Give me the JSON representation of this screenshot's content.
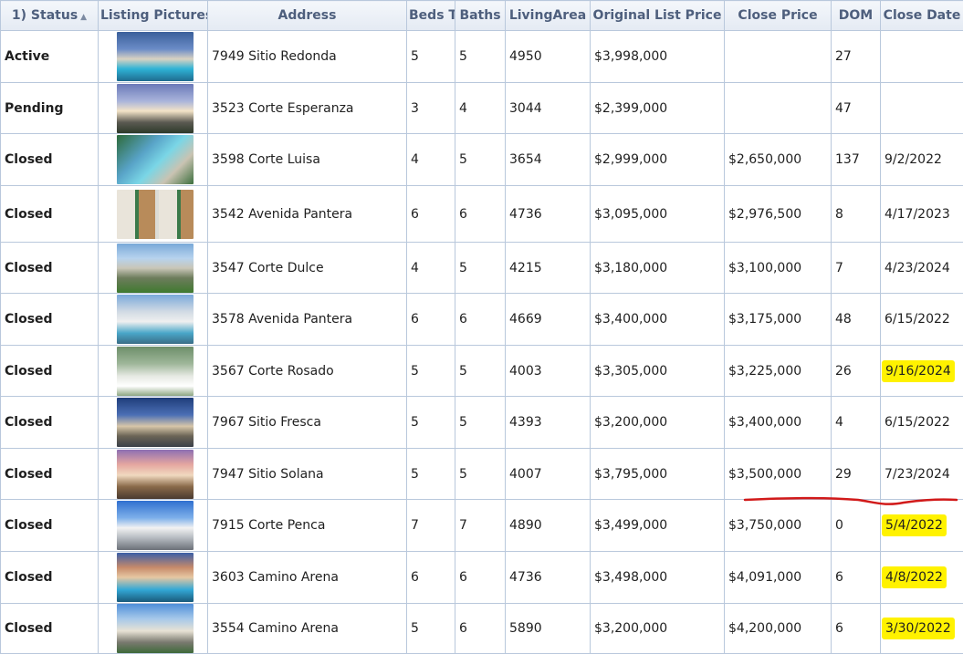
{
  "columns": [
    {
      "label": "1) Status",
      "sort_icon": "sort-arrows-icon"
    },
    {
      "label": "Listing Pictures"
    },
    {
      "label": "Address"
    },
    {
      "label": "Beds Total"
    },
    {
      "label": "Baths"
    },
    {
      "label": "LivingArea"
    },
    {
      "label": "Original List Price"
    },
    {
      "label": "Close Price"
    },
    {
      "label": "DOM"
    },
    {
      "label": "Close Date"
    }
  ],
  "rows": [
    {
      "status": "Active",
      "address": "7949 Sitio Redonda",
      "beds": "5",
      "baths": "5",
      "area": "4950",
      "orig": "$3,998,000",
      "close": "",
      "dom": "27",
      "date": "",
      "highlight": false,
      "photo": "pool-villa"
    },
    {
      "status": "Pending",
      "address": "3523 Corte Esperanza",
      "beds": "3",
      "baths": "4",
      "area": "3044",
      "orig": "$2,399,000",
      "close": "",
      "dom": "47",
      "date": "",
      "highlight": false,
      "photo": "house-dusk"
    },
    {
      "status": "Closed",
      "address": "3598 Corte Luisa",
      "beds": "4",
      "baths": "5",
      "area": "3654",
      "orig": "$2,999,000",
      "close": "$2,650,000",
      "dom": "137",
      "date": "9/2/2022",
      "highlight": false,
      "photo": "pool-aerial"
    },
    {
      "status": "Closed",
      "address": "3542 Avenida Pantera",
      "beds": "6",
      "baths": "6",
      "area": "4736",
      "orig": "$3,095,000",
      "close": "$2,976,500",
      "dom": "8",
      "date": "4/17/2023",
      "highlight": false,
      "photo": "collage"
    },
    {
      "status": "Closed",
      "address": "3547 Corte Dulce",
      "beds": "4",
      "baths": "5",
      "area": "4215",
      "orig": "$3,180,000",
      "close": "$3,100,000",
      "dom": "7",
      "date": "4/23/2024",
      "highlight": false,
      "photo": "house-lawn"
    },
    {
      "status": "Closed",
      "address": "3578 Avenida Pantera",
      "beds": "6",
      "baths": "6",
      "area": "4669",
      "orig": "$3,400,000",
      "close": "$3,175,000",
      "dom": "48",
      "date": "6/15/2022",
      "highlight": false,
      "photo": "pool-palms"
    },
    {
      "status": "Closed",
      "address": "3567 Corte Rosado",
      "beds": "5",
      "baths": "5",
      "area": "4003",
      "orig": "$3,305,000",
      "close": "$3,225,000",
      "dom": "26",
      "date": "9/16/2024",
      "highlight": true,
      "photo": "garden"
    },
    {
      "status": "Closed",
      "address": "7967 Sitio Fresca",
      "beds": "5",
      "baths": "5",
      "area": "4393",
      "orig": "$3,200,000",
      "close": "$3,400,000",
      "dom": "4",
      "date": "6/15/2022",
      "highlight": false,
      "photo": "house-night"
    },
    {
      "status": "Closed",
      "address": "7947 Sitio Solana",
      "beds": "5",
      "baths": "5",
      "area": "4007",
      "orig": "$3,795,000",
      "close": "$3,500,000",
      "dom": "29",
      "date": "7/23/2024",
      "highlight": false,
      "photo": "house-sunset"
    },
    {
      "status": "Closed",
      "address": "7915 Corte Penca",
      "beds": "7",
      "baths": "7",
      "area": "4890",
      "orig": "$3,499,000",
      "close": "$3,750,000",
      "dom": "0",
      "date": "5/4/2022",
      "highlight": true,
      "photo": "house-white"
    },
    {
      "status": "Closed",
      "address": "3603 Camino Arena",
      "beds": "6",
      "baths": "6",
      "area": "4736",
      "orig": "$3,498,000",
      "close": "$4,091,000",
      "dom": "6",
      "date": "4/8/2022",
      "highlight": true,
      "photo": "pool-evening"
    },
    {
      "status": "Closed",
      "address": "3554 Camino Arena",
      "beds": "5",
      "baths": "6",
      "area": "5890",
      "orig": "$3,200,000",
      "close": "$4,200,000",
      "dom": "6",
      "date": "3/30/2022",
      "highlight": true,
      "photo": "house-palms"
    }
  ],
  "colors": {
    "active": "#127a12",
    "pending": "#7a1a8c",
    "closed": "#1b3fd1",
    "highlight": "#fff200",
    "annotation_line": "#d11a1a",
    "header_text": "#4e5f7d",
    "grid_line": "#b9c8dc"
  }
}
